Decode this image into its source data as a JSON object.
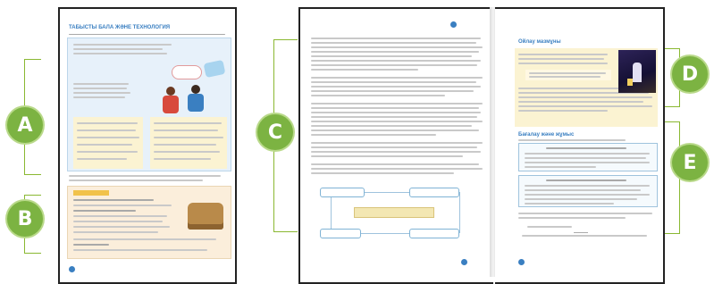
{
  "labels": [
    "A",
    "B",
    "C",
    "D",
    "E"
  ],
  "colors": {
    "badge": "#7cb342",
    "bracket": "#8ab832",
    "heading": "#3a7fc1",
    "box_blue": "#e7f1fa",
    "box_yellow": "#fbf3d2",
    "box_tan": "#fbeedb"
  },
  "pages": {
    "left": {
      "heading": "ТАБЫСТЫ БАЛА ЖӘНЕ ТЕХНОЛОГИЯ"
    },
    "right": {
      "heading_top": "Ойлау мазмұны",
      "heading_mid": "Бағалау және жұмыс"
    }
  }
}
